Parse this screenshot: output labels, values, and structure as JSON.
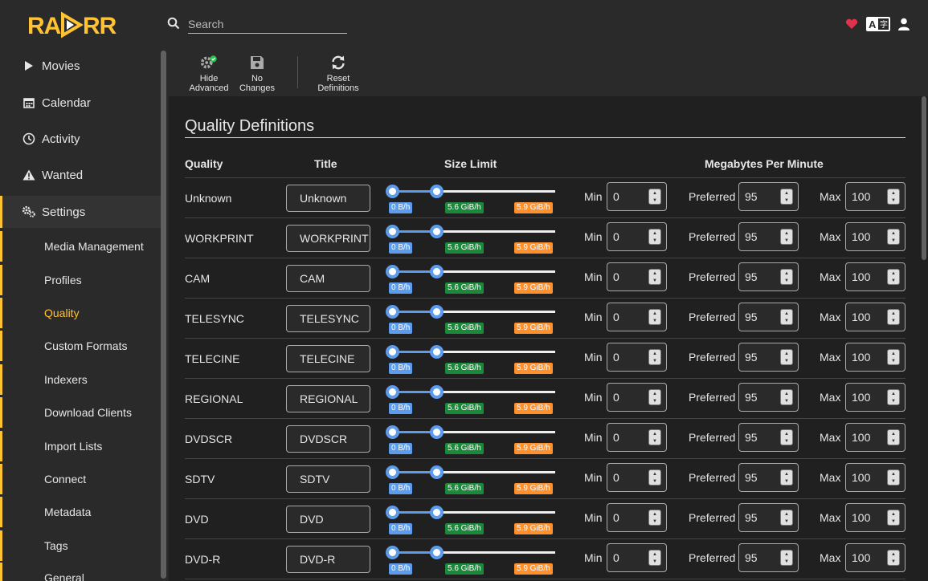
{
  "header": {
    "logo_alt": "RADARR",
    "search_placeholder": "Search",
    "heart_icon": "heart-icon",
    "translate_icon": "translate-icon",
    "user_icon": "user-icon",
    "accent": "#ffc230",
    "heart_color": "#e0324a"
  },
  "sidebar": {
    "items": [
      {
        "label": "Movies",
        "icon": "play-icon"
      },
      {
        "label": "Calendar",
        "icon": "calendar-icon"
      },
      {
        "label": "Activity",
        "icon": "clock-icon"
      },
      {
        "label": "Wanted",
        "icon": "warning-icon"
      },
      {
        "label": "Settings",
        "icon": "gears-icon"
      }
    ],
    "sub_items": [
      {
        "label": "Media Management"
      },
      {
        "label": "Profiles"
      },
      {
        "label": "Quality",
        "active": true
      },
      {
        "label": "Custom Formats"
      },
      {
        "label": "Indexers"
      },
      {
        "label": "Download Clients"
      },
      {
        "label": "Import Lists"
      },
      {
        "label": "Connect"
      },
      {
        "label": "Metadata"
      },
      {
        "label": "Tags"
      },
      {
        "label": "General"
      }
    ]
  },
  "toolbar": {
    "hide_advanced": [
      "Hide",
      "Advanced"
    ],
    "no_changes": [
      "No",
      "Changes"
    ],
    "reset_definitions": [
      "Reset",
      "Definitions"
    ]
  },
  "page": {
    "title": "Quality Definitions",
    "columns": {
      "quality": "Quality",
      "title": "Title",
      "size_limit": "Size Limit",
      "mb_per_minute": "Megabytes Per Minute"
    },
    "labels": {
      "min": "Min",
      "preferred": "Preferred",
      "max": "Max"
    }
  },
  "rows": [
    {
      "quality": "Unknown",
      "title": "Unknown",
      "min_badge": "0 B/h",
      "pref_badge": "5.6 GiB/h",
      "max_badge": "5.9 GiB/h",
      "min": "0",
      "preferred": "95",
      "max": "100"
    },
    {
      "quality": "WORKPRINT",
      "title": "WORKPRINT",
      "min_badge": "0 B/h",
      "pref_badge": "5.6 GiB/h",
      "max_badge": "5.9 GiB/h",
      "min": "0",
      "preferred": "95",
      "max": "100"
    },
    {
      "quality": "CAM",
      "title": "CAM",
      "min_badge": "0 B/h",
      "pref_badge": "5.6 GiB/h",
      "max_badge": "5.9 GiB/h",
      "min": "0",
      "preferred": "95",
      "max": "100"
    },
    {
      "quality": "TELESYNC",
      "title": "TELESYNC",
      "min_badge": "0 B/h",
      "pref_badge": "5.6 GiB/h",
      "max_badge": "5.9 GiB/h",
      "min": "0",
      "preferred": "95",
      "max": "100"
    },
    {
      "quality": "TELECINE",
      "title": "TELECINE",
      "min_badge": "0 B/h",
      "pref_badge": "5.6 GiB/h",
      "max_badge": "5.9 GiB/h",
      "min": "0",
      "preferred": "95",
      "max": "100"
    },
    {
      "quality": "REGIONAL",
      "title": "REGIONAL",
      "min_badge": "0 B/h",
      "pref_badge": "5.6 GiB/h",
      "max_badge": "5.9 GiB/h",
      "min": "0",
      "preferred": "95",
      "max": "100"
    },
    {
      "quality": "DVDSCR",
      "title": "DVDSCR",
      "min_badge": "0 B/h",
      "pref_badge": "5.6 GiB/h",
      "max_badge": "5.9 GiB/h",
      "min": "0",
      "preferred": "95",
      "max": "100"
    },
    {
      "quality": "SDTV",
      "title": "SDTV",
      "min_badge": "0 B/h",
      "pref_badge": "5.6 GiB/h",
      "max_badge": "5.9 GiB/h",
      "min": "0",
      "preferred": "95",
      "max": "100"
    },
    {
      "quality": "DVD",
      "title": "DVD",
      "min_badge": "0 B/h",
      "pref_badge": "5.6 GiB/h",
      "max_badge": "5.9 GiB/h",
      "min": "0",
      "preferred": "95",
      "max": "100"
    },
    {
      "quality": "DVD-R",
      "title": "DVD-R",
      "min_badge": "0 B/h",
      "pref_badge": "5.6 GiB/h",
      "max_badge": "5.9 GiB/h",
      "min": "0",
      "preferred": "95",
      "max": "100"
    }
  ]
}
